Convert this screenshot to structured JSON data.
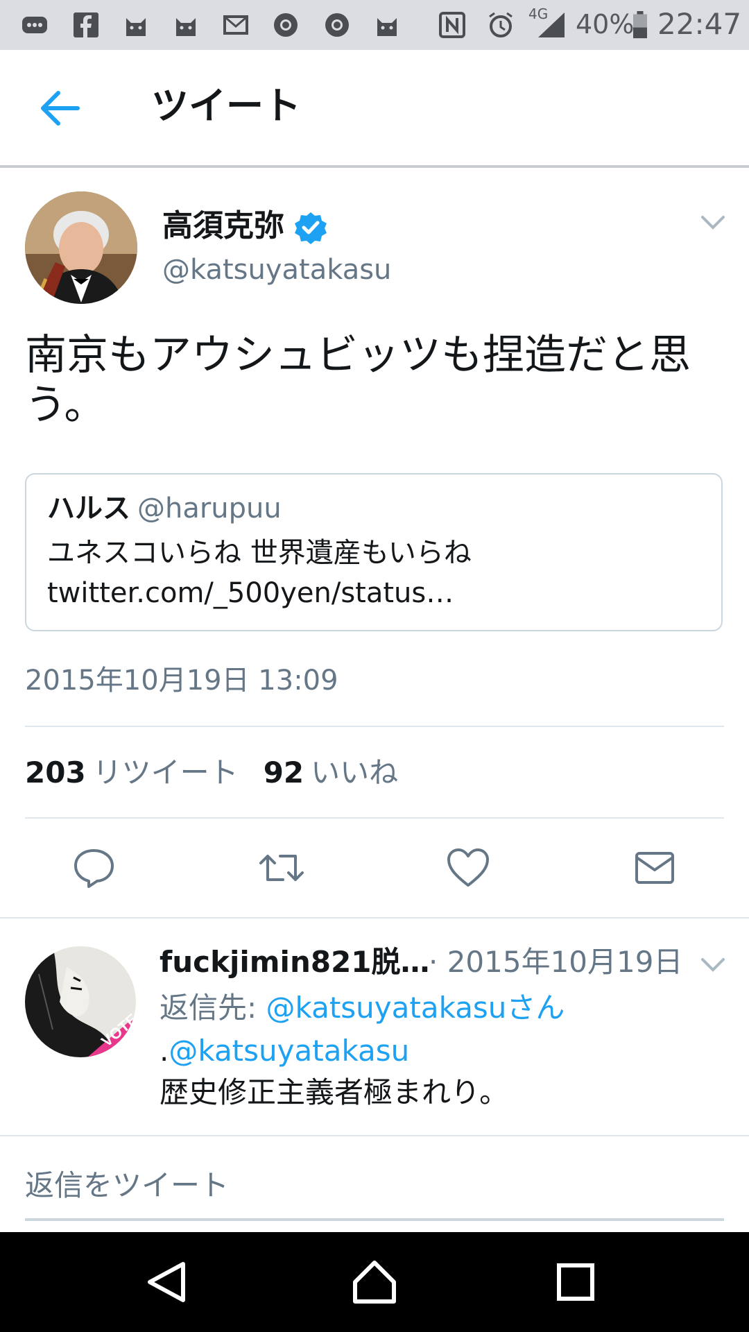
{
  "status_bar": {
    "network": "4G",
    "battery": "40%",
    "time": "22:47"
  },
  "header": {
    "title": "ツイート"
  },
  "tweet": {
    "author_name": "高須克弥",
    "author_handle": "@katsuyatakasu",
    "text": "南京もアウシュビッツも捏造だと思う。",
    "quote": {
      "name": "ハルス",
      "handle": "@harupuu",
      "text": "ユネスコいらね 世界遺産もいらね twitter.com/_500yen/status…"
    },
    "timestamp": "2015年10月19日 13:09",
    "retweet_count": "203",
    "retweet_label": "リツイート",
    "like_count": "92",
    "like_label": "いいね"
  },
  "reply": {
    "name": "fuckjimin821脱…",
    "date": "· 2015年10月19日",
    "reply_to_label": "返信先: ",
    "reply_to_handle": "@katsuyatakasuさん",
    "mention_prefix": ".",
    "mention": "@katsuyatakasu",
    "text": "歴史修正主義者極まれり。",
    "avatar_badge": "VOTE"
  },
  "reply_box": {
    "placeholder": "返信をツイート"
  },
  "colors": {
    "accent": "#1da1f2",
    "secondary_text": "#657786",
    "verified": "#1da1f2",
    "divider": "#e1e8ed"
  },
  "icons": {
    "status_left": [
      "message-icon",
      "facebook-icon",
      "cat-app-icon",
      "cat-app-icon",
      "gmail-icon",
      "chrome-icon",
      "chrome-icon",
      "cat-app-icon"
    ],
    "status_right": [
      "nfc-icon",
      "alarm-icon",
      "signal-icon",
      "battery-icon"
    ],
    "actions": [
      "reply-icon",
      "retweet-icon",
      "like-icon",
      "dm-icon"
    ],
    "nav": [
      "nav-back-icon",
      "nav-home-icon",
      "nav-recents-icon"
    ]
  }
}
